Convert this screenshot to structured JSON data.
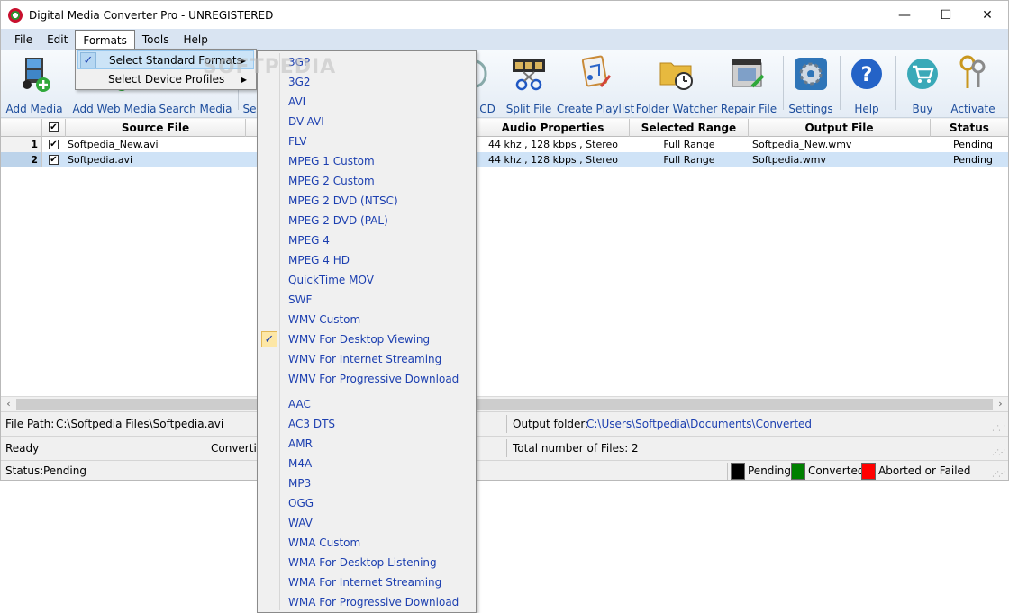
{
  "window": {
    "title": "Digital Media Converter Pro - UNREGISTERED",
    "minimize": "—",
    "maximize": "☐",
    "close": "✕"
  },
  "menubar": {
    "items": [
      "File",
      "Edit",
      "Formats",
      "Tools",
      "Help"
    ]
  },
  "toolbar": {
    "items": [
      {
        "label": "Add Media",
        "icon": "add-media-icon"
      },
      {
        "label": "Add Web Media",
        "icon": "add-web-media-icon"
      },
      {
        "label": "Search Media",
        "icon": "search-media-icon"
      },
      {
        "label": "Se",
        "icon": "select-icon"
      },
      {
        "label": "CD",
        "icon": "cd-icon"
      },
      {
        "label": "Split File",
        "icon": "split-file-icon"
      },
      {
        "label": "Create Playlist",
        "icon": "playlist-icon"
      },
      {
        "label": "Folder Watcher",
        "icon": "folder-watcher-icon"
      },
      {
        "label": "Repair File",
        "icon": "repair-file-icon"
      },
      {
        "label": "Settings",
        "icon": "settings-icon"
      },
      {
        "label": "Help",
        "icon": "help-icon"
      },
      {
        "label": "Buy",
        "icon": "cart-icon"
      },
      {
        "label": "Activate",
        "icon": "keys-icon"
      }
    ]
  },
  "grid": {
    "headers": {
      "check": "✔",
      "source": "Source File",
      "audio": "Audio Properties",
      "range": "Selected Range",
      "output": "Output File",
      "status": "Status"
    },
    "rows": [
      {
        "num": "1",
        "checked": "✔",
        "source": "Softpedia_New.avi",
        "audio": "44 khz , 128 kbps , Stereo",
        "range": "Full Range",
        "output": "Softpedia_New.wmv",
        "status": "Pending"
      },
      {
        "num": "2",
        "checked": "✔",
        "source": "Softpedia.avi",
        "audio": "44 khz , 128 kbps , Stereo",
        "range": "Full Range",
        "output": "Softpedia.wmv",
        "status": "Pending"
      }
    ]
  },
  "scrollbar": {
    "left": "‹",
    "right": "›"
  },
  "info": {
    "file_path_label": "File Path:",
    "file_path": "C:\\Softpedia Files\\Softpedia.avi",
    "output_folder_label": "Output folder:",
    "output_folder": "C:\\Users\\Softpedia\\Documents\\Converted",
    "ready": "Ready",
    "converting": "Convertin",
    "total_files": "Total number of Files: 2",
    "status_label": "Status:",
    "status_value": "Pending"
  },
  "legend": [
    {
      "label": "Pending",
      "color": "#000000"
    },
    {
      "label": "Converted",
      "color": "#008000"
    },
    {
      "label": "Aborted or Failed",
      "color": "#ff0000"
    }
  ],
  "formats_menu": {
    "items": [
      {
        "label": "Select Standard Formats",
        "check": "✓",
        "arrow": "▶"
      },
      {
        "label": "Select Device Profiles",
        "arrow": "▶"
      }
    ]
  },
  "standard_formats": {
    "video": [
      "3GP",
      "3G2",
      "AVI",
      "DV-AVI",
      "FLV",
      "MPEG 1 Custom",
      "MPEG 2 Custom",
      "MPEG 2 DVD (NTSC)",
      "MPEG 2 DVD (PAL)",
      "MPEG 4",
      "MPEG 4 HD",
      "QuickTime MOV",
      "SWF",
      "WMV Custom",
      "WMV For Desktop Viewing",
      "WMV For Internet Streaming",
      "WMV For Progressive Download"
    ],
    "audio": [
      "AAC",
      "AC3 DTS",
      "AMR",
      "M4A",
      "MP3",
      "OGG",
      "WAV",
      "WMA Custom",
      "WMA For Desktop Listening",
      "WMA For Internet Streaming",
      "WMA For Progressive Download"
    ],
    "selected": "WMV For Desktop Viewing",
    "selected_check": "✓"
  },
  "watermark": "SOFTPEDIA"
}
